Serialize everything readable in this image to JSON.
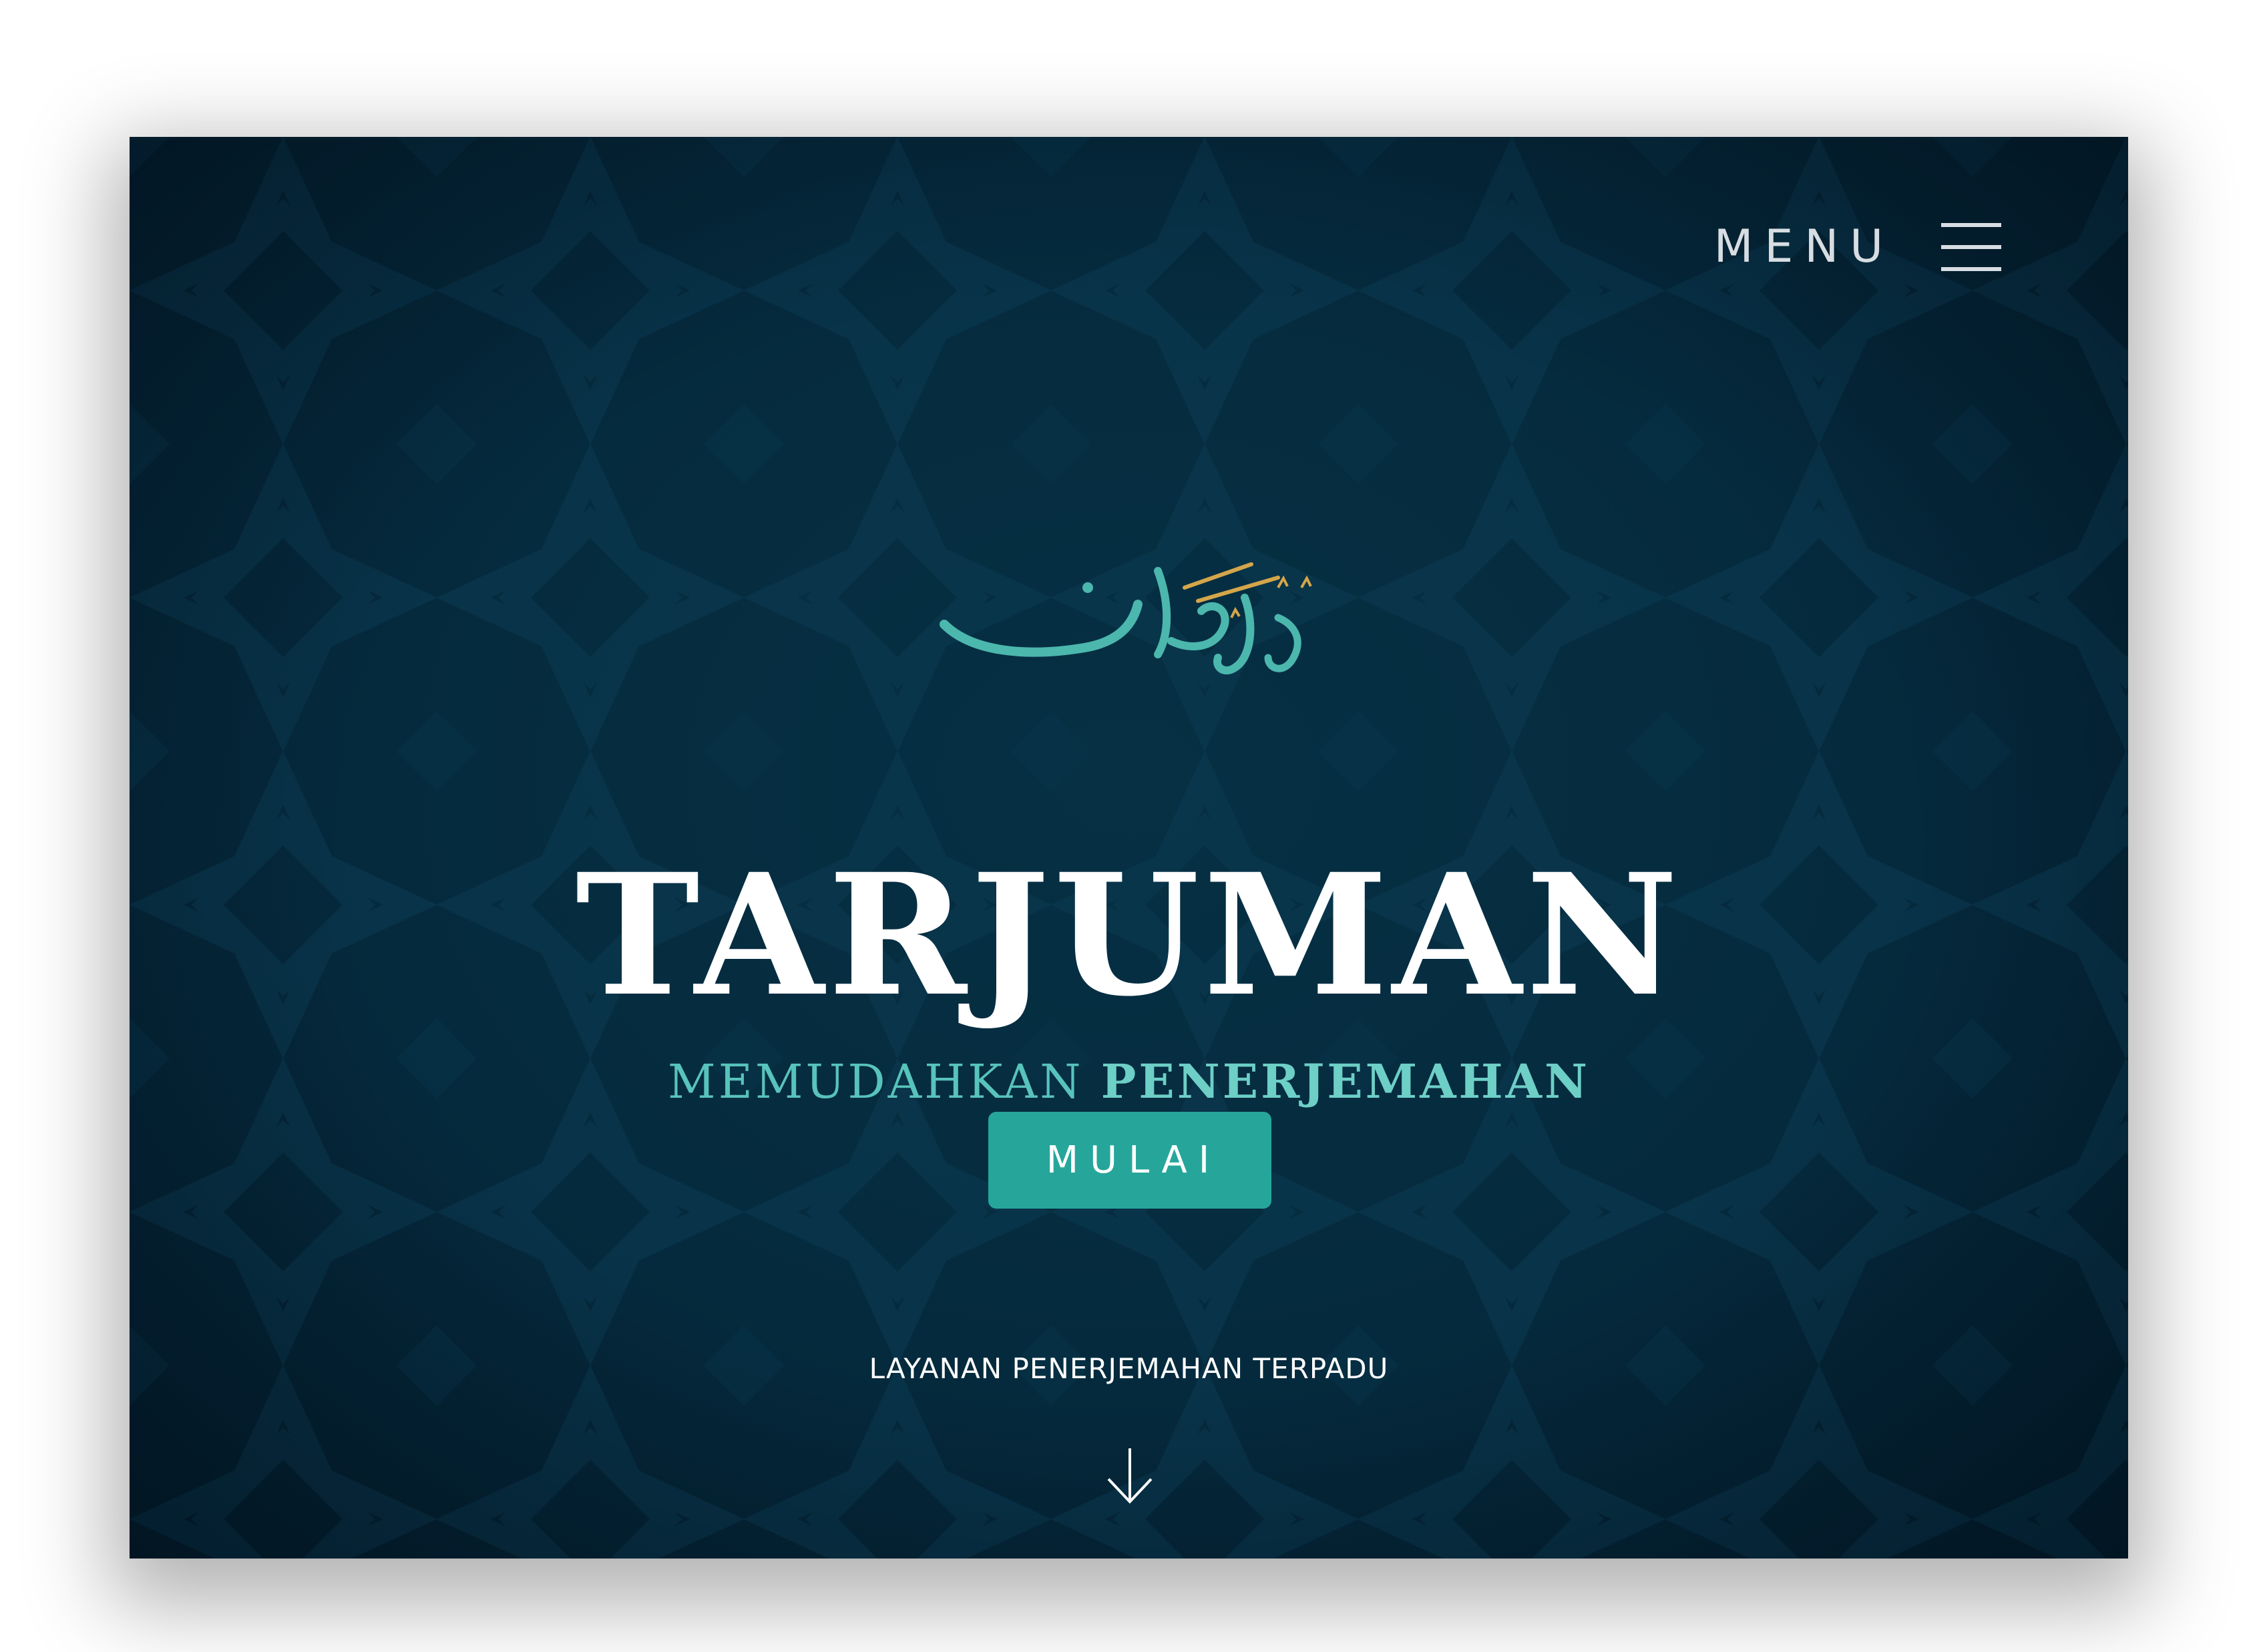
{
  "header": {
    "menu_label": "MENU",
    "menu_icon": "hamburger-icon"
  },
  "hero": {
    "logo_icon": "arabic-calligraphy-logo",
    "title": "TARJUMAN",
    "subtitle_light": "MEMUDAHKAN",
    "subtitle_strong": "PENERJEMAHAN",
    "cta_label": "MULAI",
    "tagline": "LAYANAN PENERJEMAHAN TERPADU",
    "scroll_icon": "arrow-down-icon"
  },
  "colors": {
    "background": "#052a3d",
    "accent_teal": "#26a69a",
    "subtitle_teal": "#58c3bb",
    "gold": "#d4a64a",
    "text_white": "#ffffff"
  }
}
